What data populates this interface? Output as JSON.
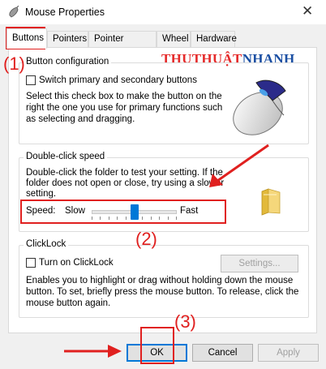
{
  "window": {
    "title": "Mouse Properties",
    "close_glyph": "✕"
  },
  "tabs": [
    {
      "label": "Buttons",
      "active": true
    },
    {
      "label": "Pointers",
      "active": false
    },
    {
      "label": "Pointer Options",
      "active": false
    },
    {
      "label": "Wheel",
      "active": false
    },
    {
      "label": "Hardware",
      "active": false
    }
  ],
  "watermark": {
    "part1": "THUTHUẬT",
    "part2": "NHANH"
  },
  "button_config": {
    "title": "Button configuration",
    "checkbox_label": "Switch primary and secondary buttons",
    "checked": false,
    "description": [
      "Select this check box to make the button on the",
      "right the one you use for primary functions such",
      "as selecting and dragging."
    ],
    "image_icon": "mouse-icon"
  },
  "double_click": {
    "title": "Double-click speed",
    "description": [
      "Double-click the folder to test your setting. If the",
      "folder does not open or close, try using a slower",
      "setting."
    ],
    "speed_label": "Speed:",
    "slow_label": "Slow",
    "fast_label": "Fast",
    "slider_position_fraction": 0.5,
    "folder_icon": "folder-icon"
  },
  "clicklock": {
    "title": "ClickLock",
    "checkbox_label": "Turn on ClickLock",
    "checked": false,
    "settings_button": "Settings...",
    "description": [
      "Enables you to highlight or drag without holding down the mouse",
      "button. To set, briefly press the mouse button. To release, click the",
      "mouse button again."
    ]
  },
  "annotations": {
    "label1": "(1)",
    "label2": "(2)",
    "label3": "(3)",
    "color": "#e0201f"
  },
  "footer": {
    "ok": "OK",
    "cancel": "Cancel",
    "apply": "Apply"
  }
}
